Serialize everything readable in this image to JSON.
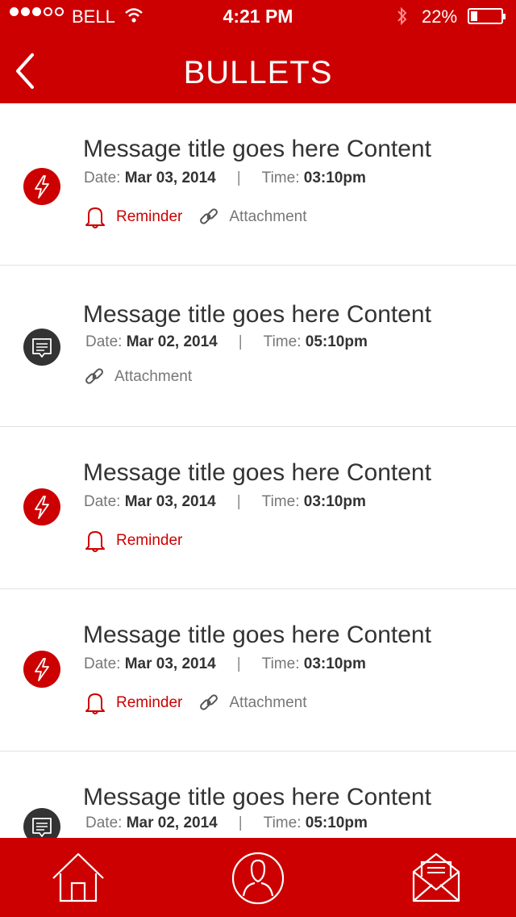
{
  "status_bar": {
    "carrier": "BELL",
    "time": "4:21 PM",
    "battery": "22%",
    "signal_dots_filled": 3,
    "signal_dots_total": 5
  },
  "nav": {
    "title": "BULLETS"
  },
  "labels": {
    "date": "Date:",
    "time": "Time:"
  },
  "messages": [
    {
      "type": "alert",
      "title": "Message title goes here Content",
      "date": "Mar 03, 2014",
      "time": "03:10pm",
      "reminder": "Reminder",
      "attachment": "Attachment"
    },
    {
      "type": "message",
      "title": "Message title goes here Content",
      "date": "Mar 02, 2014",
      "time": "05:10pm",
      "reminder": "",
      "attachment": "Attachment"
    },
    {
      "type": "alert",
      "title": "Message title goes here Content",
      "date": "Mar 03, 2014",
      "time": "03:10pm",
      "reminder": "Reminder",
      "attachment": ""
    },
    {
      "type": "alert",
      "title": "Message title goes here Content",
      "date": "Mar 03, 2014",
      "time": "03:10pm",
      "reminder": "Reminder",
      "attachment": "Attachment"
    },
    {
      "type": "message",
      "title": "Message title goes here Content",
      "date": "Mar 02, 2014",
      "time": "05:10pm",
      "reminder": "",
      "attachment": ""
    }
  ],
  "tabs": [
    {
      "icon": "home-icon"
    },
    {
      "icon": "profile-icon"
    },
    {
      "icon": "mail-icon"
    }
  ],
  "colors": {
    "accent": "#cc0000",
    "dark_icon": "#333333",
    "text": "#333333",
    "muted": "#777777"
  }
}
